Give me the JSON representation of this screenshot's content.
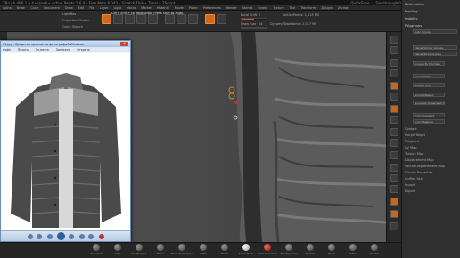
{
  "titlebar": {
    "items": [
      "ZBrush 4R6 1.6.4 ▸ mesh ▸ Active Points 1.6.4 ▸ Free Mem 8.043 ▸ Scratch Disk ▸ Timer ▸ ZScript"
    ],
    "right": [
      "QuickSave",
      "See-through 0",
      "Menus",
      "DefaultZScript"
    ]
  },
  "menubar": {
    "items": [
      "Alpha",
      "Brush",
      "Color",
      "Document",
      "Draw",
      "Edit",
      "File",
      "Layer",
      "Light",
      "Macro",
      "Marker",
      "Material",
      "Movie",
      "Picker",
      "Preferences",
      "Render",
      "Stencil",
      "Stroke",
      "Texture",
      "Tool",
      "Transform",
      "Zplugin",
      "Zscript"
    ]
  },
  "toolbar": {
    "lightbox": "LightBox",
    "projection": "Projection Master",
    "quicksketch": "Quick Sketch",
    "notice": "Ctrl+ Shift+ to Reposition. Press Shift to Align.",
    "focal_label": "Focal Shift",
    "focal_value": "0",
    "draw_label": "Draw Size",
    "draw_value": "64",
    "dynamic": "Dynamic",
    "active_points": "ActivePoints: 1,513 Mil",
    "total_points": "TotalPoints: 2,017 Mil"
  },
  "photo_viewer": {
    "title": "01.jpg - Средство просмотра фотографий Windows",
    "menu": [
      "Файл",
      "Печать",
      "Эл.почта",
      "Записать",
      "Открыть"
    ],
    "image_alt": "Quilted down jacket photo"
  },
  "palette": {
    "header1": "Deformation",
    "header2": "Masking",
    "header3": "Visibility",
    "header4": "Polygroups",
    "items": [
      "Auto Groups",
      "Merge Similar Groups",
      "Merge Stray Groups",
      "Groups By Normals",
      "GroupVisible",
      "Group Front",
      "Group Masked",
      "Group As Dynamesh Sub",
      "From Polypaint",
      "From Masking",
      "Contact",
      "Morph Target",
      "Polypaint",
      "UV Map",
      "Texture Map",
      "Displacement Map",
      "Vector Displacement Map",
      "Display Properties",
      "Unified Skin",
      "Import",
      "Export"
    ]
  },
  "bottombar": {
    "brushes": [
      "Standard",
      "Clay",
      "ClayBuildup",
      "Move",
      "Move Topological",
      "Inflat",
      "Polish",
      "SnakeHook",
      "Dam Standard",
      "TrimDynamic",
      "Hpolish",
      "Pinch",
      "Flatten",
      "Slash3"
    ]
  }
}
